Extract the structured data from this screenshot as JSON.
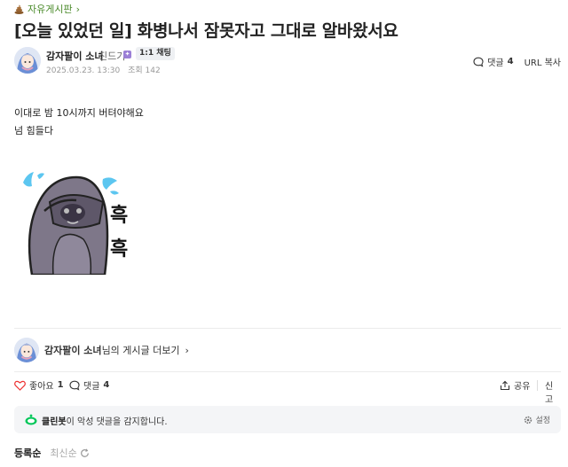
{
  "board": {
    "name": "자유게시판",
    "chevron": "›"
  },
  "post": {
    "title": "[오늘 있었던 일] 화병나서 잠못자고 그대로 알바왔서요",
    "author": "감자팔이 소녀",
    "grade": "진드기",
    "chat_label": "1:1 채팅",
    "date": "2025.03.23. 13:30",
    "views": "조회 142",
    "comment_label": "댓글",
    "comment_count": "4",
    "url_copy": "URL 복사",
    "lines": [
      "이대로 밤 10시까지 버텨야해요",
      "넘 힘들다"
    ],
    "sticker_text": [
      "흑",
      "흑"
    ]
  },
  "more_posts": {
    "author": "감자팔이 소녀",
    "suffix": "님의 게시글 더보기",
    "chevron": "›"
  },
  "actions": {
    "like_label": "좋아요",
    "like_count": "1",
    "comment_label": "댓글",
    "comment_count": "4",
    "share": "공유",
    "report": "신고"
  },
  "cleanbot": {
    "name": "클린봇",
    "message": "이 악성 댓글을 감지합니다.",
    "settings": "설정"
  },
  "sort": {
    "active": "등록순",
    "inactive": "최신순"
  },
  "colors": {
    "brand_green": "#03c75a",
    "board_green": "#4a8a2a",
    "text": "#222222",
    "muted": "#999999"
  },
  "icons": [
    "poo-icon",
    "avatar",
    "comment-icon",
    "heart-icon",
    "share-icon",
    "refresh-icon",
    "gear-icon",
    "cleanbot-icon"
  ]
}
